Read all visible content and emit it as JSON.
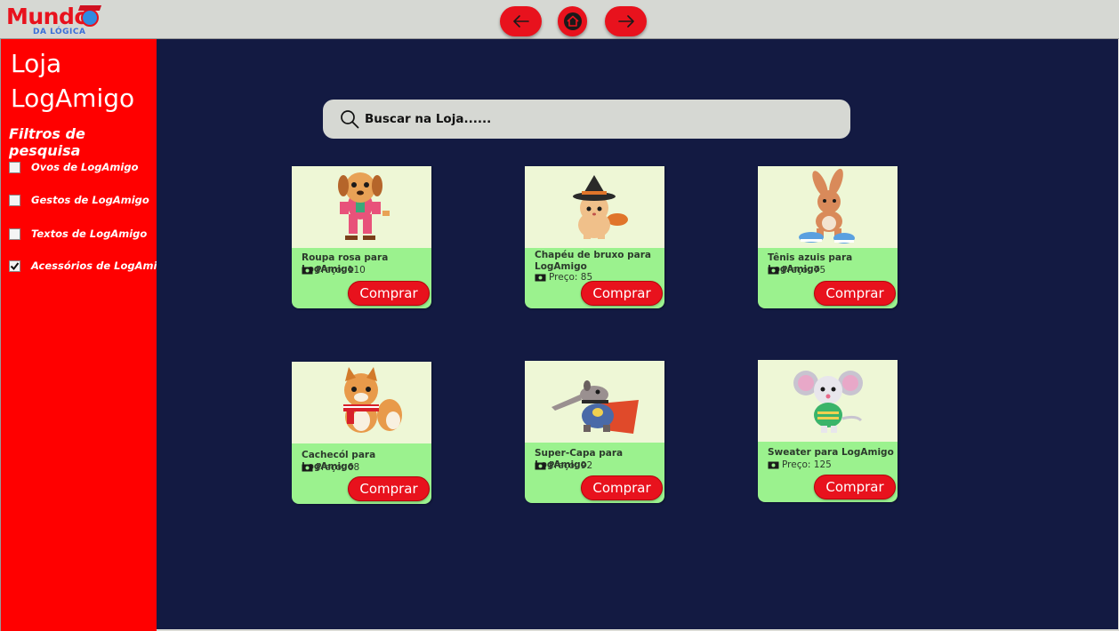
{
  "header": {
    "logo": {
      "word1": "Mundo",
      "word2": "DA LÓGICA"
    },
    "nav": {
      "back_icon": "arrow-left-icon",
      "home_icon": "home-icon",
      "forward_icon": "arrow-right-icon"
    }
  },
  "sidebar": {
    "title": "Loja LogAmigo",
    "filters_title": "Filtros de pesquisa",
    "filters": [
      {
        "label": "Ovos de LogAmigo",
        "checked": false
      },
      {
        "label": "Gestos de LogAmigo",
        "checked": false
      },
      {
        "label": "Textos de LogAmigo",
        "checked": false
      },
      {
        "label": "Acessórios de LogAmigo",
        "checked": true
      }
    ]
  },
  "search": {
    "placeholder": "Buscar na Loja......",
    "icon": "search-icon"
  },
  "products": [
    {
      "name": "Roupa rosa para LogAmigo",
      "price_label": "Preço: 110",
      "buy_label": "Comprar",
      "image": "dog-pink-outfit"
    },
    {
      "name": "Chapéu de bruxo para LogAmigo",
      "price_label": "Preço: 85",
      "buy_label": "Comprar",
      "image": "cat-witch-hat"
    },
    {
      "name": "Tênis azuis para LogAmigo",
      "price_label": "Preço: 75",
      "buy_label": "Comprar",
      "image": "rabbit-blue-sneakers"
    },
    {
      "name": "Cachecól para LogAmigo",
      "price_label": "Preço: 68",
      "buy_label": "Comprar",
      "image": "fox-red-scarf"
    },
    {
      "name": "Super-Capa para LogAmigo",
      "price_label": "Preço: 92",
      "buy_label": "Comprar",
      "image": "anteater-super-cape"
    },
    {
      "name": "Sweater para LogAmigo",
      "price_label": "Preço: 125",
      "buy_label": "Comprar",
      "image": "mouse-green-sweater"
    }
  ],
  "colors": {
    "accent_red": "#e8121d",
    "sidebar_red": "#ff0000",
    "main_bg": "#131a42",
    "card_green": "#9bf28e",
    "image_bg": "#eef7d6",
    "topbar": "#d6d8d3"
  }
}
